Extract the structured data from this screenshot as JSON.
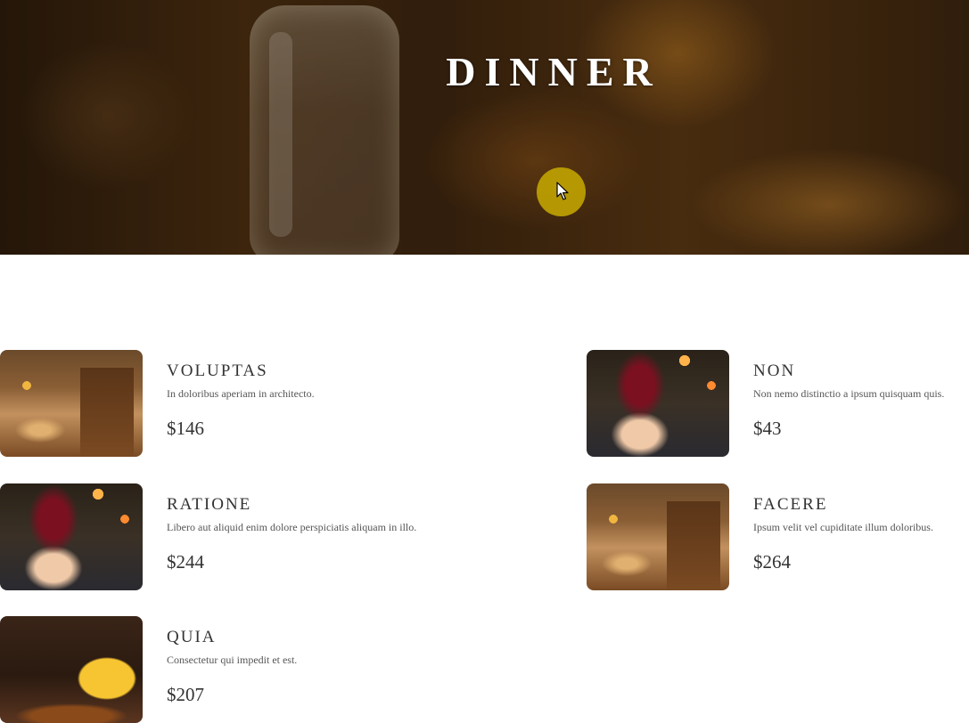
{
  "hero": {
    "title": "DINNER"
  },
  "menu": {
    "items": [
      {
        "name": "VOLUPTAS",
        "description": "In doloribus aperiam in architecto.",
        "price": "$146",
        "image": "bar-counter"
      },
      {
        "name": "NON",
        "description": "Non nemo distinctio a ipsum quisquam quis.",
        "price": "$43",
        "image": "wine-glass"
      },
      {
        "name": "RATIONE",
        "description": "Libero aut aliquid enim dolore perspiciatis aliquam in illo.",
        "price": "$244",
        "image": "wine-glass"
      },
      {
        "name": "FACERE",
        "description": "Ipsum velit vel cupiditate illum doloribus.",
        "price": "$264",
        "image": "bar-counter"
      },
      {
        "name": "QUIA",
        "description": "Consectetur qui impedit et est.",
        "price": "$207",
        "image": "cheese"
      }
    ]
  },
  "cursor": {
    "icon": "pointer-arrow-icon",
    "highlight_color": "#c8aa00"
  }
}
